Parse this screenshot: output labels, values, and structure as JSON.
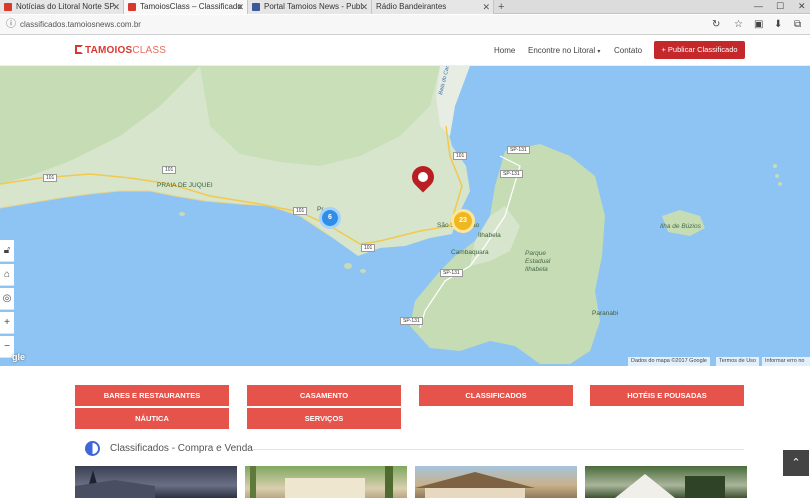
{
  "browser": {
    "tabs": [
      {
        "label": "Notícias do Litoral Norte SP",
        "favicon_color": "#d9382f",
        "active": false
      },
      {
        "label": "TamoiosClass – Classificado",
        "favicon_color": "#d9382f",
        "active": true
      },
      {
        "label": "Portal Tamoios News - Publ",
        "favicon_color": "#3b5998",
        "active": false
      },
      {
        "label": "Rádio Bandeirantes",
        "favicon_color": "",
        "active": false
      }
    ],
    "url": "classificados.tamoiosnews.com.br"
  },
  "header": {
    "logo_part1": "TAMOIOS",
    "logo_part2": "CLASS",
    "menu": {
      "home": "Home",
      "encontre": "Encontre no Litoral",
      "contato": "Contato"
    },
    "publish_label": "+ Publicar Classificado"
  },
  "map": {
    "labels": {
      "praia_juquei": "PRAIA DE JUQUEI",
      "sao_sebastiao": "São Sebastião",
      "ilhabela": "Ilhabela",
      "cambaquara": "Cambaquara",
      "parque": "Parque",
      "estadual": "Estadual",
      "ilhabela_park": "Ilhabela",
      "ilha_buzios": "Ilha de Búzios",
      "paranabi": "Paranabi",
      "baia": "Baía do Caraguatatuba",
      "pr_label": "Pr"
    },
    "roads": {
      "r101a": "101",
      "r101b": "101",
      "r101c": "101",
      "r101d": "101",
      "r101e": "101",
      "sp131a": "SP-131",
      "sp131b": "SP-131",
      "sp131c": "SP-131",
      "sp131d": "SP-131"
    },
    "clusters": {
      "blue": "6",
      "yellow": "23"
    },
    "attribution": {
      "data": "Dados do mapa ©2017 Google",
      "terms": "Termos de Uso",
      "report": "Informar erro no"
    },
    "google": "gle"
  },
  "categories": [
    {
      "label": "BARES E RESTAURANTES"
    },
    {
      "label": "CASAMENTO"
    },
    {
      "label": "CLASSIFICADOS"
    },
    {
      "label": "HOTÉIS E POUSADAS"
    },
    {
      "label": "NÁUTICA"
    },
    {
      "label": "SERVIÇOS"
    }
  ],
  "section": {
    "title": "Classificados - Compra e Venda"
  },
  "colors": {
    "brand_red": "#d9382f",
    "button_red": "#e5534b",
    "publish_red": "#c5282a",
    "sea": "#8ec4f3",
    "land": "#d7e5cc"
  }
}
